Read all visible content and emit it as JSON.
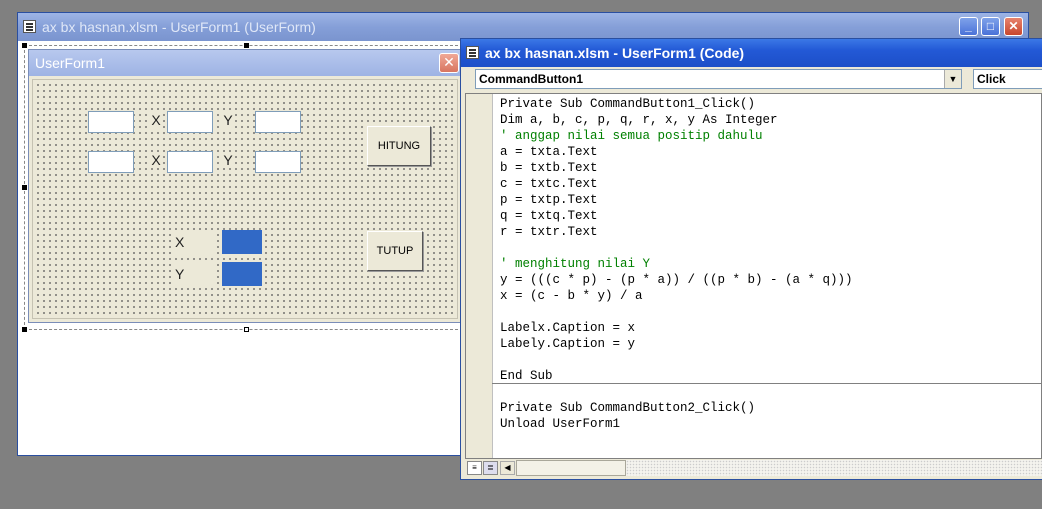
{
  "designer_window": {
    "title": "ax bx hasnan.xlsm - UserForm1 (UserForm)",
    "min_btn": "_",
    "max_btn": "□",
    "close_btn": "✕"
  },
  "userform": {
    "title": "UserForm1",
    "close_btn": "✕",
    "row1": {
      "lbl_x": "X",
      "lbl_y": "Y"
    },
    "row2": {
      "lbl_x": "X",
      "lbl_y": "Y"
    },
    "hitung_label": "HITUNG",
    "tutup_label": "TUTUP",
    "out_x_label": "X",
    "out_y_label": "Y",
    "output_color": "#3169c6"
  },
  "code_window": {
    "title": "ax bx hasnan.xlsm - UserForm1 (Code)",
    "object_combo": "CommandButton1",
    "proc_combo": "Click",
    "combo_arrow": "▼",
    "lines": [
      {
        "text": "Private Sub CommandButton1_Click()",
        "type": "normal"
      },
      {
        "text": "Dim a, b, c, p, q, r, x, y As Integer",
        "type": "normal"
      },
      {
        "text": "' anggap nilai semua positip dahulu",
        "type": "comment"
      },
      {
        "text": "a = txta.Text",
        "type": "normal"
      },
      {
        "text": "b = txtb.Text",
        "type": "normal"
      },
      {
        "text": "c = txtc.Text",
        "type": "normal"
      },
      {
        "text": "p = txtp.Text",
        "type": "normal"
      },
      {
        "text": "q = txtq.Text",
        "type": "normal"
      },
      {
        "text": "r = txtr.Text",
        "type": "normal"
      },
      {
        "text": "",
        "type": "normal"
      },
      {
        "text": "' menghitung nilai Y",
        "type": "comment"
      },
      {
        "text": "y = (((c * p) - (p * a)) / ((p * b) - (a * q)))",
        "type": "normal"
      },
      {
        "text": "x = (c - b * y) / a",
        "type": "normal"
      },
      {
        "text": "",
        "type": "normal"
      },
      {
        "text": "Labelx.Caption = x",
        "type": "normal"
      },
      {
        "text": "Labely.Caption = y",
        "type": "normal"
      },
      {
        "text": "",
        "type": "normal"
      },
      {
        "text": "End Sub",
        "type": "normal"
      },
      {
        "text": "",
        "type": "separator"
      },
      {
        "text": "Private Sub CommandButton2_Click()",
        "type": "normal"
      },
      {
        "text": "Unload UserForm1",
        "type": "normal"
      }
    ],
    "scroll_left": "◀"
  }
}
